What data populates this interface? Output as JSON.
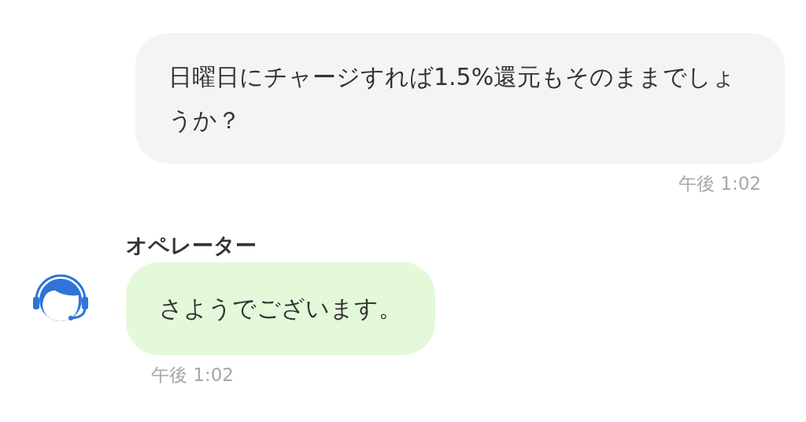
{
  "messages": [
    {
      "kind": "sent",
      "text": "日曜日にチャージすれば1.5%還元もそのままでしょうか？",
      "time": "午後 1:02"
    },
    {
      "kind": "received",
      "sender": "オペレーター",
      "text": "さようでございます。",
      "time": "午後 1:02"
    }
  ]
}
